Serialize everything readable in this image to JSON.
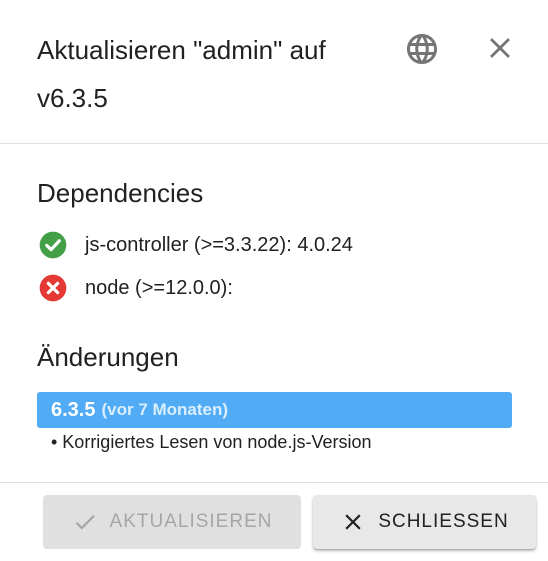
{
  "dialog": {
    "title": "Aktualisieren \"admin\" auf v6.3.5",
    "icons": {
      "language": "globe-icon",
      "close": "close-icon"
    }
  },
  "dependencies": {
    "title": "Dependencies",
    "items": [
      {
        "label": "js-controller (>=3.3.22): 4.0.24",
        "status": "ok",
        "status_color": "#43a047"
      },
      {
        "label": "node (>=12.0.0):",
        "status": "error",
        "status_color": "#e53935"
      }
    ]
  },
  "changes": {
    "title": "Änderungen",
    "version": "6.3.5",
    "age": "(vor 7 Monaten)",
    "entries": [
      "• Korrigiertes Lesen von node.js-Version"
    ],
    "bar_color": "#52acf5"
  },
  "footer": {
    "update_label": "AKTUALISIEREN",
    "update_disabled": true,
    "close_label": "SCHLIESSEN"
  }
}
